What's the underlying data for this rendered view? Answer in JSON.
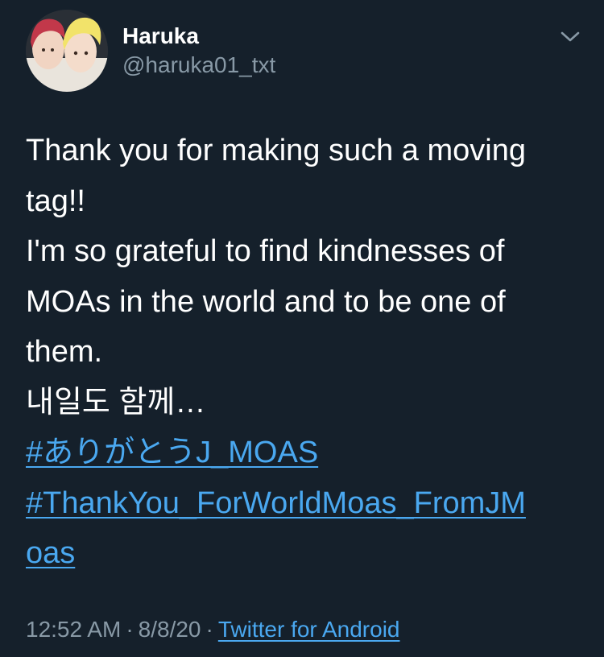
{
  "tweet": {
    "display_name": "Haruka",
    "handle": "@haruka01_txt",
    "lines": [
      "Thank you for making such a moving",
      "tag!!",
      "I'm so grateful to find kindnesses of",
      "MOAs in the world and to be one of",
      "them.",
      "내일도 함께…"
    ],
    "hashtag_1": "#ありがとうJ_MOAS",
    "hashtag_2_line_1": "#ThankYou_ForWorldMoas_FromJM",
    "hashtag_2_line_2": "oas",
    "time": "12:52 AM",
    "date": "8/8/20",
    "separator": "·",
    "source": "Twitter for Android"
  },
  "icons": {
    "menu": "chevron-down-icon",
    "avatar": "profile-photo"
  },
  "colors": {
    "background": "#15202b",
    "text_primary": "#ffffff",
    "text_secondary": "#8899a6",
    "link": "#4aa8f0"
  }
}
